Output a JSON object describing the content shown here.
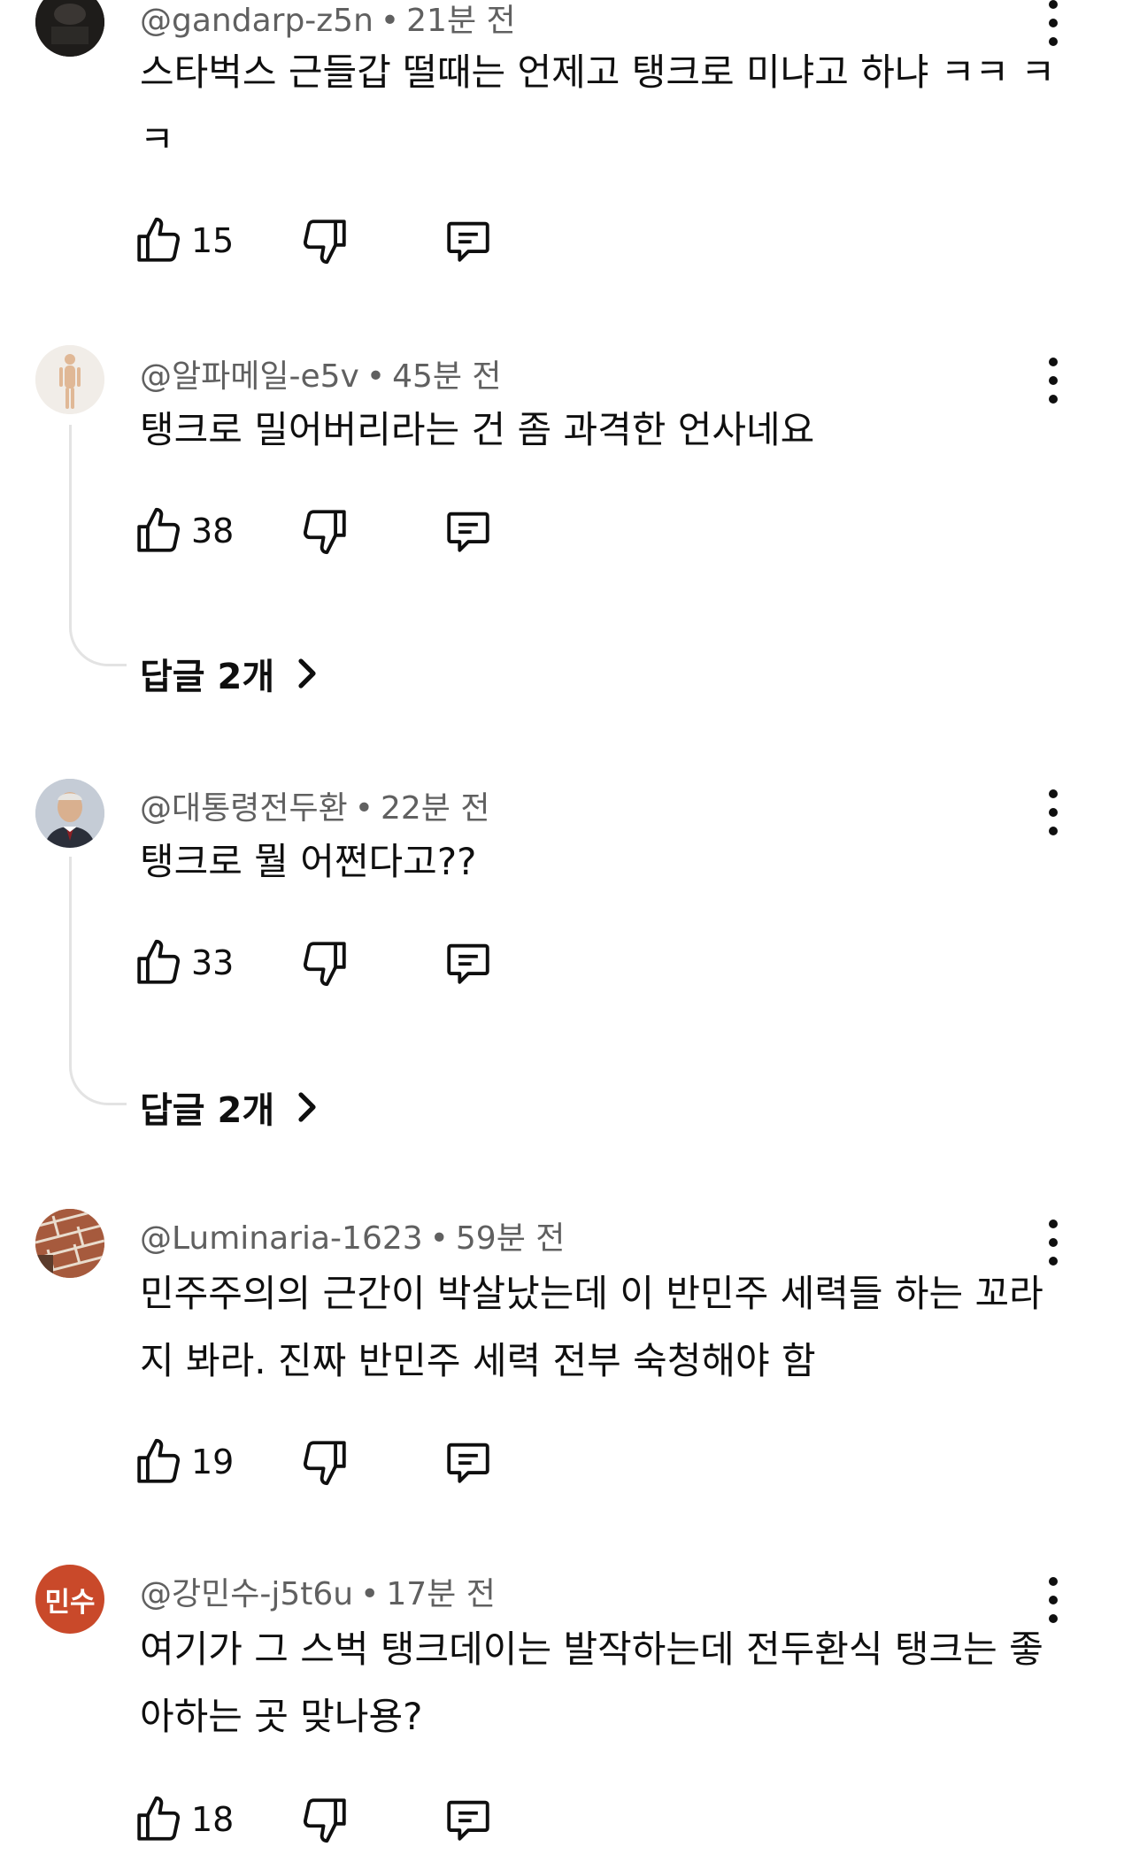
{
  "comments": [
    {
      "handle": "@gandarp-z5n",
      "time": "21분 전",
      "text": "스타벅스 근들갑 떨때는 언제고 탱크로 미냐고 하냐 ㅋㅋ ㅋㅋ",
      "likes": "15",
      "avatar": "dark-photo-avatar"
    },
    {
      "handle": "@알파메일-e5v",
      "time": "45분 전",
      "text": "탱크로 밀어버리라는 건 좀 과격한 언사네요",
      "likes": "38",
      "replies": "답글 2개",
      "avatar": "anatomy-figure-avatar"
    },
    {
      "handle": "@대통령전두환",
      "time": "22분 전",
      "text": "탱크로 뭘 어쩐다고??",
      "likes": "33",
      "replies": "답글 2개",
      "avatar": "portrait-photo-avatar"
    },
    {
      "handle": "@Luminaria-1623",
      "time": "59분 전",
      "text": "민주주의의 근간이 박살났는데 이 반민주 세력들 하는 꼬라지 봐라. 진짜 반민주 세력 전부 숙청해야 함",
      "likes": "19",
      "avatar": "brick-photo-avatar"
    },
    {
      "handle": "@강민수-j5t6u",
      "time": "17분 전",
      "text": "여기가 그 스벅 탱크데이는 발작하는데 전두환식 탱크는 좋아하는 곳 맞나용?",
      "likes": "18",
      "avatar_text": "민수",
      "avatar_color": "#c9492a"
    }
  ],
  "icons": {
    "like": "thumbs-up-icon",
    "dislike": "thumbs-down-icon",
    "reply": "comment-reply-icon",
    "more": "more-vertical-icon",
    "chevron": "chevron-right-icon"
  }
}
